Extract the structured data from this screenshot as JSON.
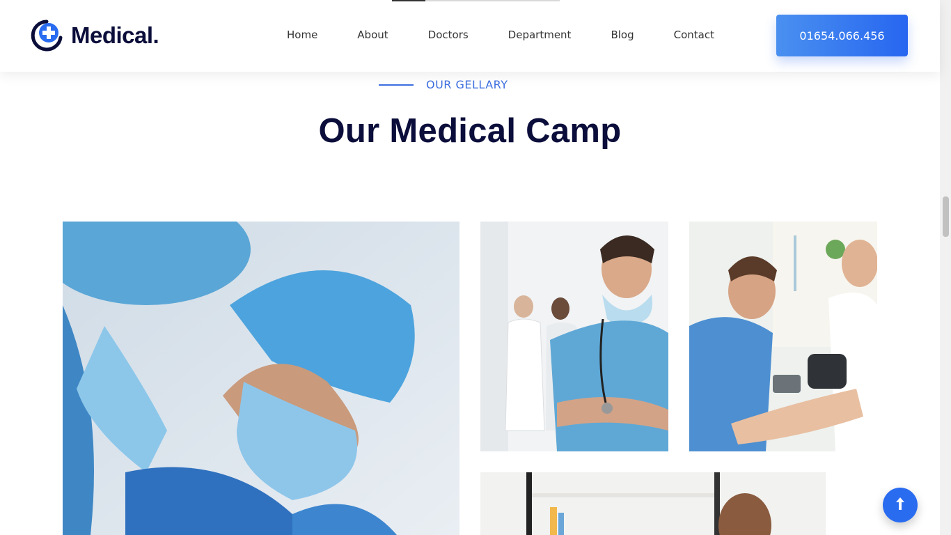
{
  "brand": {
    "name": "Medical",
    "dot": "."
  },
  "nav": {
    "items": [
      {
        "label": "Home"
      },
      {
        "label": "About"
      },
      {
        "label": "Doctors"
      },
      {
        "label": "Department"
      },
      {
        "label": "Blog"
      },
      {
        "label": "Contact"
      }
    ],
    "phone": "01654.066.456"
  },
  "section": {
    "eyebrow": "OUR GELLARY",
    "title": "Our Medical Camp"
  },
  "gallery": [
    {
      "icon": "surgeon-photo"
    },
    {
      "icon": "doctor-crossed-arms-photo"
    },
    {
      "icon": "blood-pressure-photo"
    },
    {
      "icon": "patient-photo"
    }
  ],
  "icons": {
    "back_to_top": "arrow-up-icon",
    "logo": "medical-cross-icon"
  },
  "colors": {
    "primary": "#2a6cf0",
    "heading": "#0b0d3a",
    "accent": "#3d6fe0"
  }
}
